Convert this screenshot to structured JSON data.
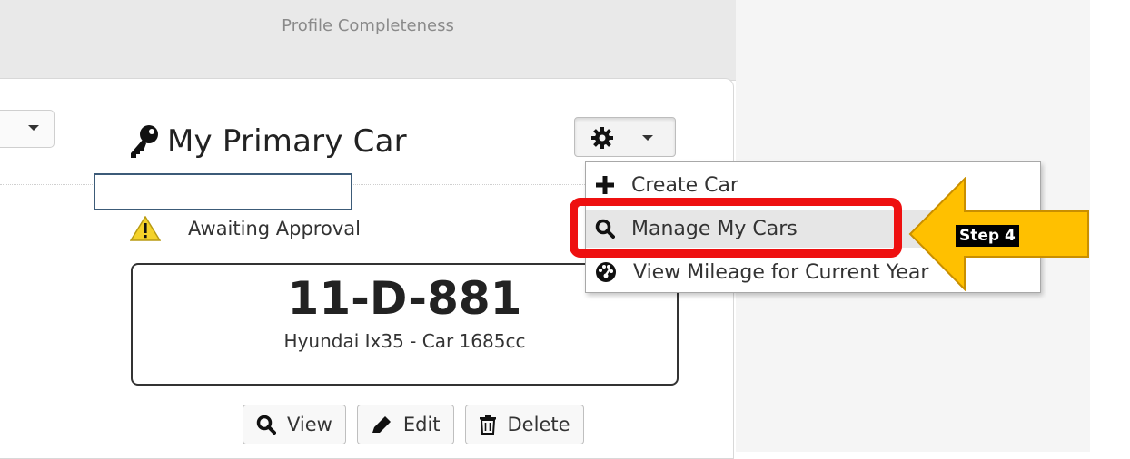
{
  "header": {
    "title": "Profile Completeness"
  },
  "card": {
    "title": "My Primary Car",
    "status": "Awaiting Approval",
    "plate": "11-D-881",
    "model": "Hyundai Ix35 - Car 1685cc"
  },
  "actions": {
    "view": "View",
    "edit": "Edit",
    "delete": "Delete"
  },
  "menu": {
    "items": [
      {
        "label": "Create Car",
        "icon": "plus-icon"
      },
      {
        "label": "Manage My Cars",
        "icon": "search-icon"
      },
      {
        "label": "View Mileage for Current Year",
        "icon": "dashboard-icon"
      }
    ]
  },
  "annotation": {
    "step": "Step 4",
    "highlight_color": "#ee1010",
    "arrow_color": "#ffc000"
  }
}
